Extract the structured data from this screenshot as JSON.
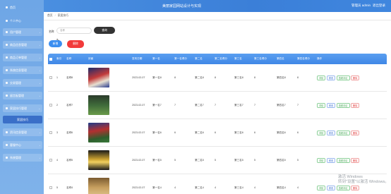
{
  "header": {
    "title": "美丽家园网站设计与实现",
    "user_label": "管理员 admin",
    "logout": "退出登录"
  },
  "sidebar": {
    "items": [
      {
        "label": "首页",
        "type": "home"
      },
      {
        "label": "个人中心",
        "type": "plain"
      },
      {
        "label": "用户管理",
        "type": "menu"
      },
      {
        "label": "商品信息管理",
        "type": "menu"
      },
      {
        "label": "商品订单管理",
        "type": "menu"
      },
      {
        "label": "系统信息管理",
        "type": "menu"
      },
      {
        "label": "交易管理",
        "type": "menu"
      },
      {
        "label": "留言板管理",
        "type": "menu"
      },
      {
        "label": "家居技巧管理",
        "type": "menu"
      },
      {
        "label": "家居技巧",
        "type": "active"
      },
      {
        "label": "资讯信息管理",
        "type": "menu"
      },
      {
        "label": "客服中心",
        "type": "menu"
      },
      {
        "label": "系统管理",
        "type": "menu"
      }
    ]
  },
  "breadcrumb": {
    "home": "首页",
    "sep": "/",
    "current": "家居技巧"
  },
  "search": {
    "label": "名称",
    "placeholder": "名称",
    "button": "查询"
  },
  "actions": {
    "add": "新增",
    "delete": "删除"
  },
  "table": {
    "headers": [
      "",
      "索引",
      "名称",
      "封面",
      "发布日期",
      "第一名",
      "第一名得分",
      "第二名",
      "第二名得分",
      "第三名",
      "第三名得分",
      "第四名",
      "第四名得分",
      "操作"
    ],
    "op_labels": {
      "detail": "详情",
      "edit": "修改",
      "review": "查看评论",
      "remove": "删除"
    },
    "rows": [
      {
        "index": "1",
        "name": "名称8",
        "date": "2023-02-07",
        "a": "第一名8",
        "as": "8",
        "b": "第二名8",
        "bs": "8",
        "c": "第三名8",
        "cs": "8",
        "d": "第四名8",
        "ds": "8",
        "img": "img-1"
      },
      {
        "index": "2",
        "name": "名称7",
        "date": "2023-02-07",
        "a": "第一名7",
        "as": "7",
        "b": "第二名7",
        "bs": "7",
        "c": "第三名7",
        "cs": "7",
        "d": "第四名7",
        "ds": "7",
        "img": "img-2"
      },
      {
        "index": "3",
        "name": "名称6",
        "date": "2023-02-07",
        "a": "第一名6",
        "as": "6",
        "b": "第二名6",
        "bs": "6",
        "c": "第三名6",
        "cs": "6",
        "d": "第四名6",
        "ds": "6",
        "img": "img-3"
      },
      {
        "index": "4",
        "name": "名称5",
        "date": "2023-02-07",
        "a": "第一名5",
        "as": "5",
        "b": "第二名5",
        "bs": "5",
        "c": "第三名5",
        "cs": "5",
        "d": "第四名5",
        "ds": "5",
        "img": "img-4"
      },
      {
        "index": "5",
        "name": "名称4",
        "date": "2023-02-07",
        "a": "第一名4",
        "as": "4",
        "b": "第二名4",
        "bs": "4",
        "c": "第三名4",
        "cs": "4",
        "d": "第四名4",
        "ds": "4",
        "img": "img-5"
      }
    ]
  },
  "watermark": {
    "line1": "激活 Windows",
    "line2": "转到\"设置\"以激活 Windows。"
  },
  "colors": {
    "header": "#3b7fd8",
    "sidebar": "#78aee8",
    "primary": "#3b8ef0",
    "danger": "#f23b3b",
    "dark": "#333333"
  }
}
